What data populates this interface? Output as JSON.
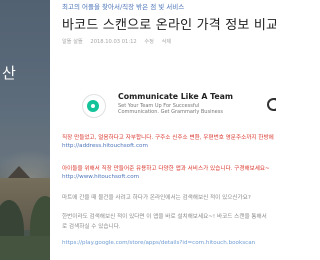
{
  "sidebar": {
    "title": "산"
  },
  "post": {
    "category": "최고의 어플을 찾아서/직장 밖은 점 빛 서비스",
    "title": "바코드 스캔으로 온라인 가격 정보 비교 - 다",
    "meta": [
      "알뜰 살뜰",
      "2018.10.03 01:12",
      "수정",
      "삭제"
    ]
  },
  "ad": {
    "headline": "Communicate Like A Team",
    "subtext": "Set Your Team Up For Successful Communication. Get Grammarly Business",
    "logo_color": "#15c39a"
  },
  "body": {
    "p1": "직장 만들었고, 얼음하다고 자부합니다. 구주소 신주소 변환, 우편번호 영문주소까지 한방에",
    "p1_link": "http://address.hitouchsoft.com",
    "p2": "아이들을 위해서 직장 만들어준 유용하고 다양한 앱과 서비스가 있습니다. 구경해보세요~",
    "p2_link": "http://www.hitouchsoft.com",
    "p3": "마트에 간을 때 물건을 사려고 하다가 온라인에서는 검색해보신 적이 있으신가요?",
    "p4a": "한번이라도 검색해보신 적이 있다면 이 앱을 바로 설치해보세요~! 바코드 스캔을 통해서",
    "p4b": "로 검색하실 수 있습니다.",
    "store_link": "https://play.google.com/store/apps/details?id=com.hitouch.bookscan"
  },
  "colors": {
    "accent_link": "#4a73b8",
    "highlight_red": "#d9352b"
  }
}
